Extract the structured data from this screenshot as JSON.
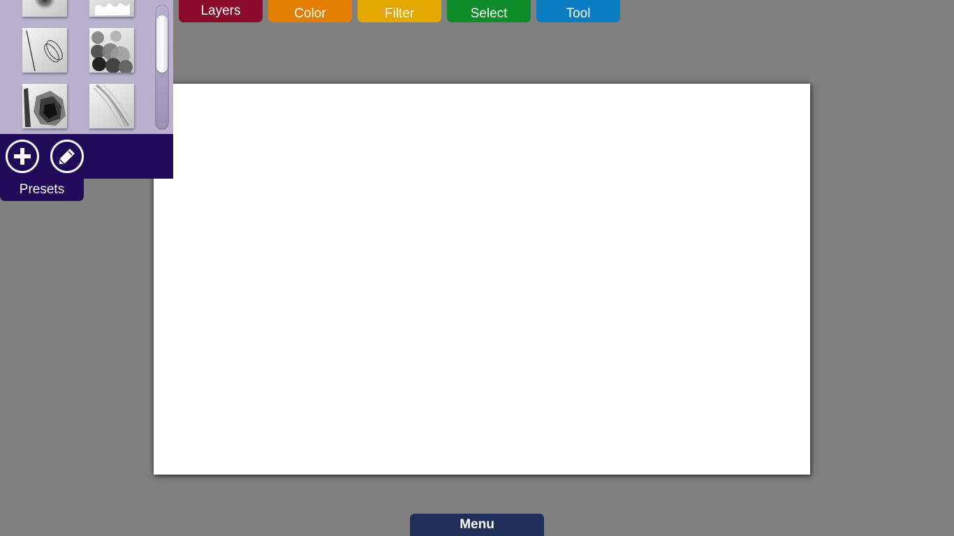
{
  "tabs": {
    "layers": {
      "label": "Layers",
      "color": "#8b0a2a"
    },
    "color": {
      "label": "Color",
      "color": "#e37f00"
    },
    "filter": {
      "label": "Filter",
      "color": "#e3a700"
    },
    "select": {
      "label": "Select",
      "color": "#0f8c2a"
    },
    "tool": {
      "label": "Tool",
      "color": "#0a7dc2"
    }
  },
  "brushes": {
    "items": [
      {
        "name": "soft-round-brush"
      },
      {
        "name": "splatter-brush"
      },
      {
        "name": "pencil-brush"
      },
      {
        "name": "blend-dots-brush"
      },
      {
        "name": "dry-bristle-brush"
      },
      {
        "name": "hair-stroke-brush"
      }
    ],
    "panel_color": "#b9b1cf"
  },
  "presets": {
    "label": "Presets",
    "add_icon": "plus-circle-icon",
    "edit_icon": "pencil-icon",
    "bar_color": "#1e0a57"
  },
  "menu": {
    "label": "Menu",
    "color": "#1f2f5a"
  },
  "canvas": {
    "background": "#ffffff"
  },
  "workspace": {
    "background": "#808080"
  }
}
